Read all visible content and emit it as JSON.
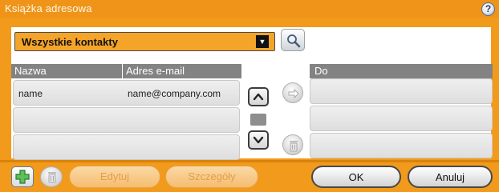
{
  "window": {
    "title": "Książka adresowa",
    "help_label": "?"
  },
  "filter": {
    "selected": "Wszystkie kontakty"
  },
  "contacts_table": {
    "columns": [
      "Nazwa",
      "Adres e-mail"
    ],
    "rows": [
      {
        "name": "name",
        "email": "name@company.com"
      },
      {
        "name": "",
        "email": ""
      },
      {
        "name": "",
        "email": ""
      }
    ]
  },
  "recipients": {
    "header": "Do",
    "rows": [
      "",
      "",
      ""
    ]
  },
  "toolbar": {
    "edit_label": "Edytuj",
    "details_label": "Szczegóły",
    "ok_label": "OK",
    "cancel_label": "Anuluj"
  },
  "colors": {
    "accent": "#f29a1b",
    "header_gray": "#838383"
  }
}
